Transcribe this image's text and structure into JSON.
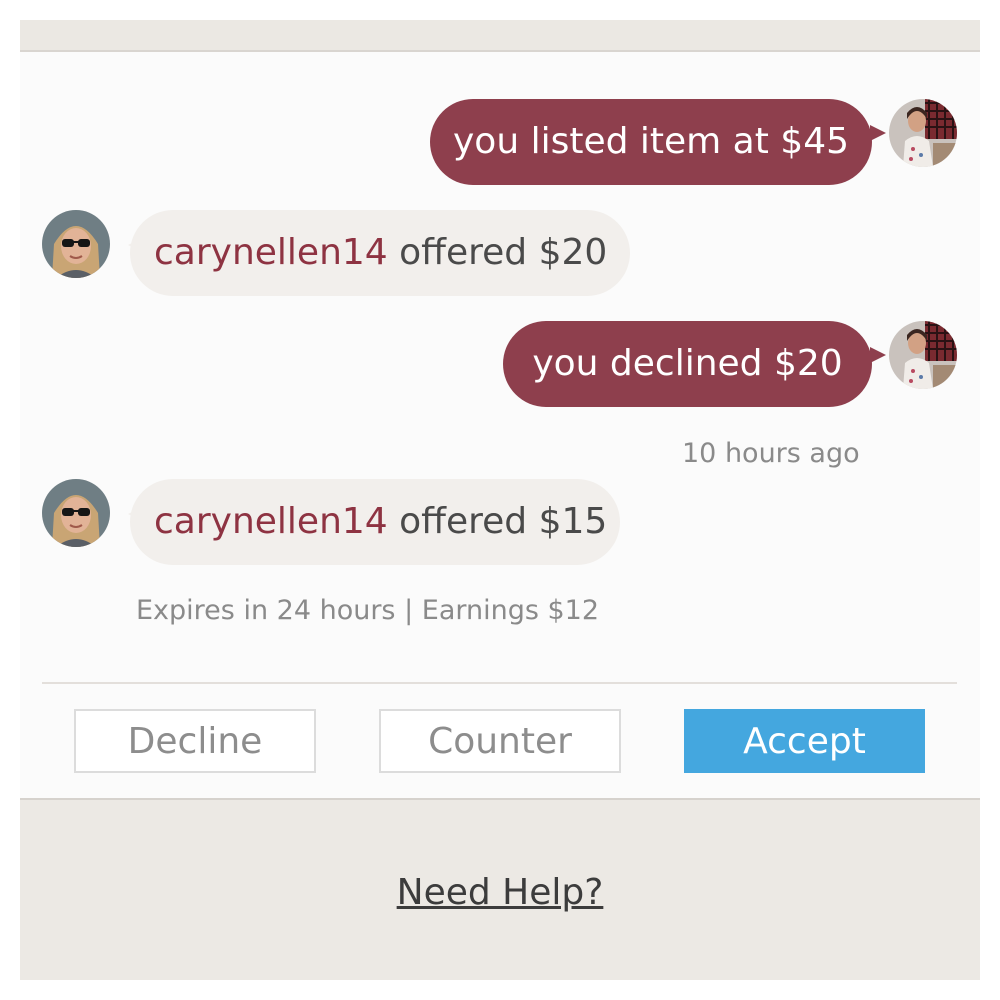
{
  "messages": [
    {
      "kind": "outgoing",
      "text": "you listed item at $45"
    },
    {
      "kind": "incoming",
      "user": "carynellen14",
      "text": " offered $20"
    },
    {
      "kind": "outgoing",
      "text": "you declined $20",
      "timestamp": "10 hours ago"
    },
    {
      "kind": "incoming",
      "user": "carynellen14",
      "text": " offered $15",
      "meta": "Expires in 24 hours | Earnings $12"
    }
  ],
  "actions": {
    "decline_label": "Decline",
    "counter_label": "Counter",
    "accept_label": "Accept"
  },
  "footer": {
    "help_label": "Need Help?"
  },
  "colors": {
    "outgoing_bubble": "#8e3f4d",
    "incoming_bubble": "#f2efec",
    "username": "#8e3342",
    "accept_button": "#44a7df"
  },
  "icons": {
    "seller_avatar": "seller-avatar-icon",
    "buyer_avatar": "buyer-avatar-icon"
  }
}
